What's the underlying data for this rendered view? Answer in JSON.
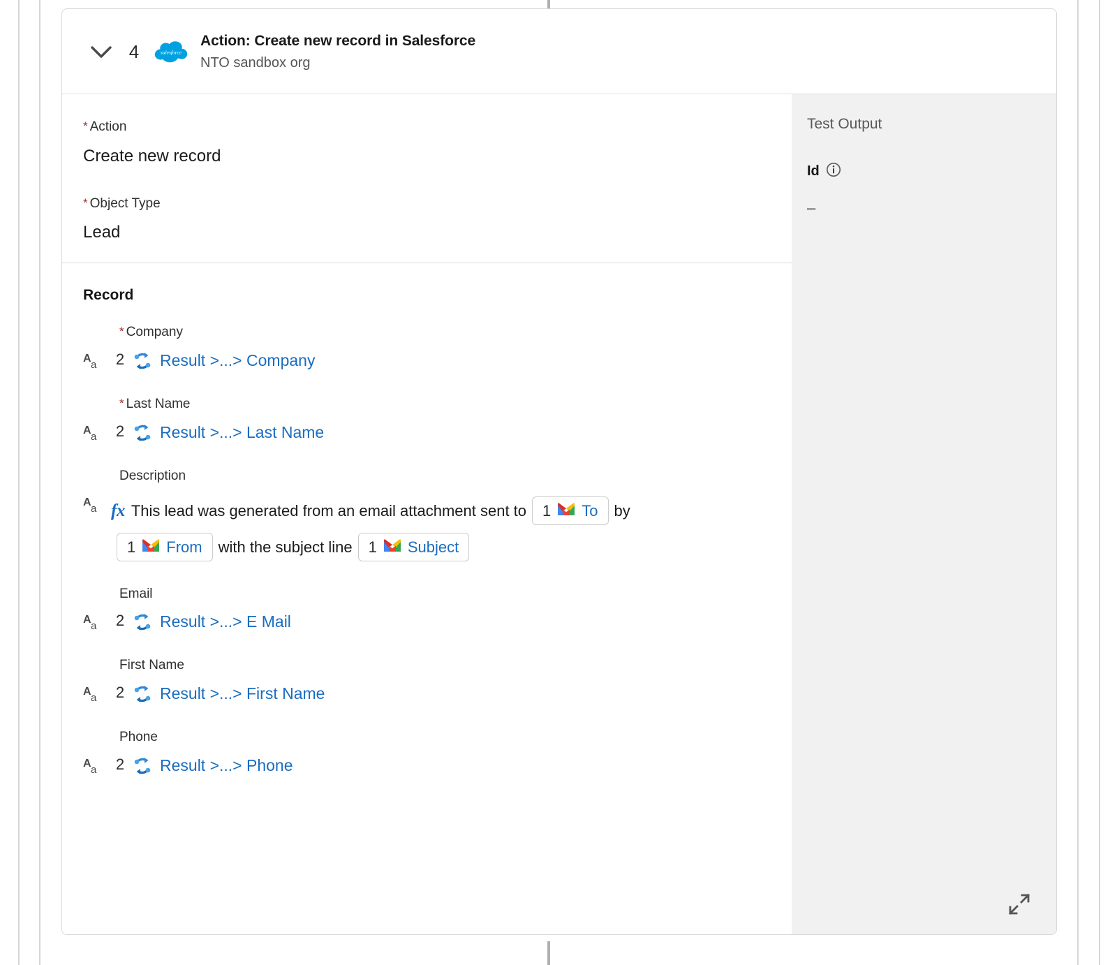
{
  "header": {
    "collapse_icon": "chevron-down-icon",
    "step_number": "4",
    "app_icon": "salesforce-cloud-icon",
    "title": "Action: Create new record in Salesforce",
    "subtitle": "NTO sandbox org"
  },
  "form": {
    "action": {
      "required_marker": "*",
      "label": "Action",
      "value": "Create new record"
    },
    "object_type": {
      "required_marker": "*",
      "label": "Object Type",
      "value": "Lead"
    }
  },
  "record": {
    "title": "Record",
    "fields": [
      {
        "required_marker": "*",
        "required": true,
        "label": "Company",
        "type_icon": "text-type-icon",
        "ref_step": "2",
        "ref_icon": "flow-loop-icon",
        "ref_text": "Result >...> Company"
      },
      {
        "required_marker": "*",
        "required": true,
        "label": "Last Name",
        "type_icon": "text-type-icon",
        "ref_step": "2",
        "ref_icon": "flow-loop-icon",
        "ref_text": "Result >...> Last Name"
      },
      {
        "required_marker": "",
        "required": false,
        "label": "Email",
        "type_icon": "text-type-icon",
        "ref_step": "2",
        "ref_icon": "flow-loop-icon",
        "ref_text": "Result >...> E Mail"
      },
      {
        "required_marker": "",
        "required": false,
        "label": "First Name",
        "type_icon": "text-type-icon",
        "ref_step": "2",
        "ref_icon": "flow-loop-icon",
        "ref_text": "Result >...> First Name"
      },
      {
        "required_marker": "",
        "required": false,
        "label": "Phone",
        "type_icon": "text-type-icon",
        "ref_step": "2",
        "ref_icon": "flow-loop-icon",
        "ref_text": "Result >...> Phone"
      }
    ],
    "description": {
      "label": "Description",
      "type_icon": "text-type-icon",
      "formula_icon": "fx",
      "text_1": "This lead was generated from an email attachment sent to",
      "chip_to": {
        "num": "1",
        "icon": "gmail-icon",
        "label": "To"
      },
      "text_2": "by",
      "chip_from": {
        "num": "1",
        "icon": "gmail-icon",
        "label": "From"
      },
      "text_3": "with the subject line",
      "chip_subject": {
        "num": "1",
        "icon": "gmail-icon",
        "label": "Subject"
      }
    }
  },
  "test_output": {
    "title": "Test Output",
    "key": "Id",
    "info_icon": "info-circle-icon",
    "value": "–",
    "expand_icon": "expand-diagonal-icon"
  },
  "colors": {
    "link_blue": "#1a6dbf",
    "required_red": "#9e2a2a",
    "salesforce_blue": "#00a1e0",
    "panel_gray": "#f1f1f1",
    "gmail_red": "#ea4335",
    "gmail_blue": "#4285f4",
    "gmail_green": "#34a853",
    "gmail_yellow": "#fbbc04"
  }
}
